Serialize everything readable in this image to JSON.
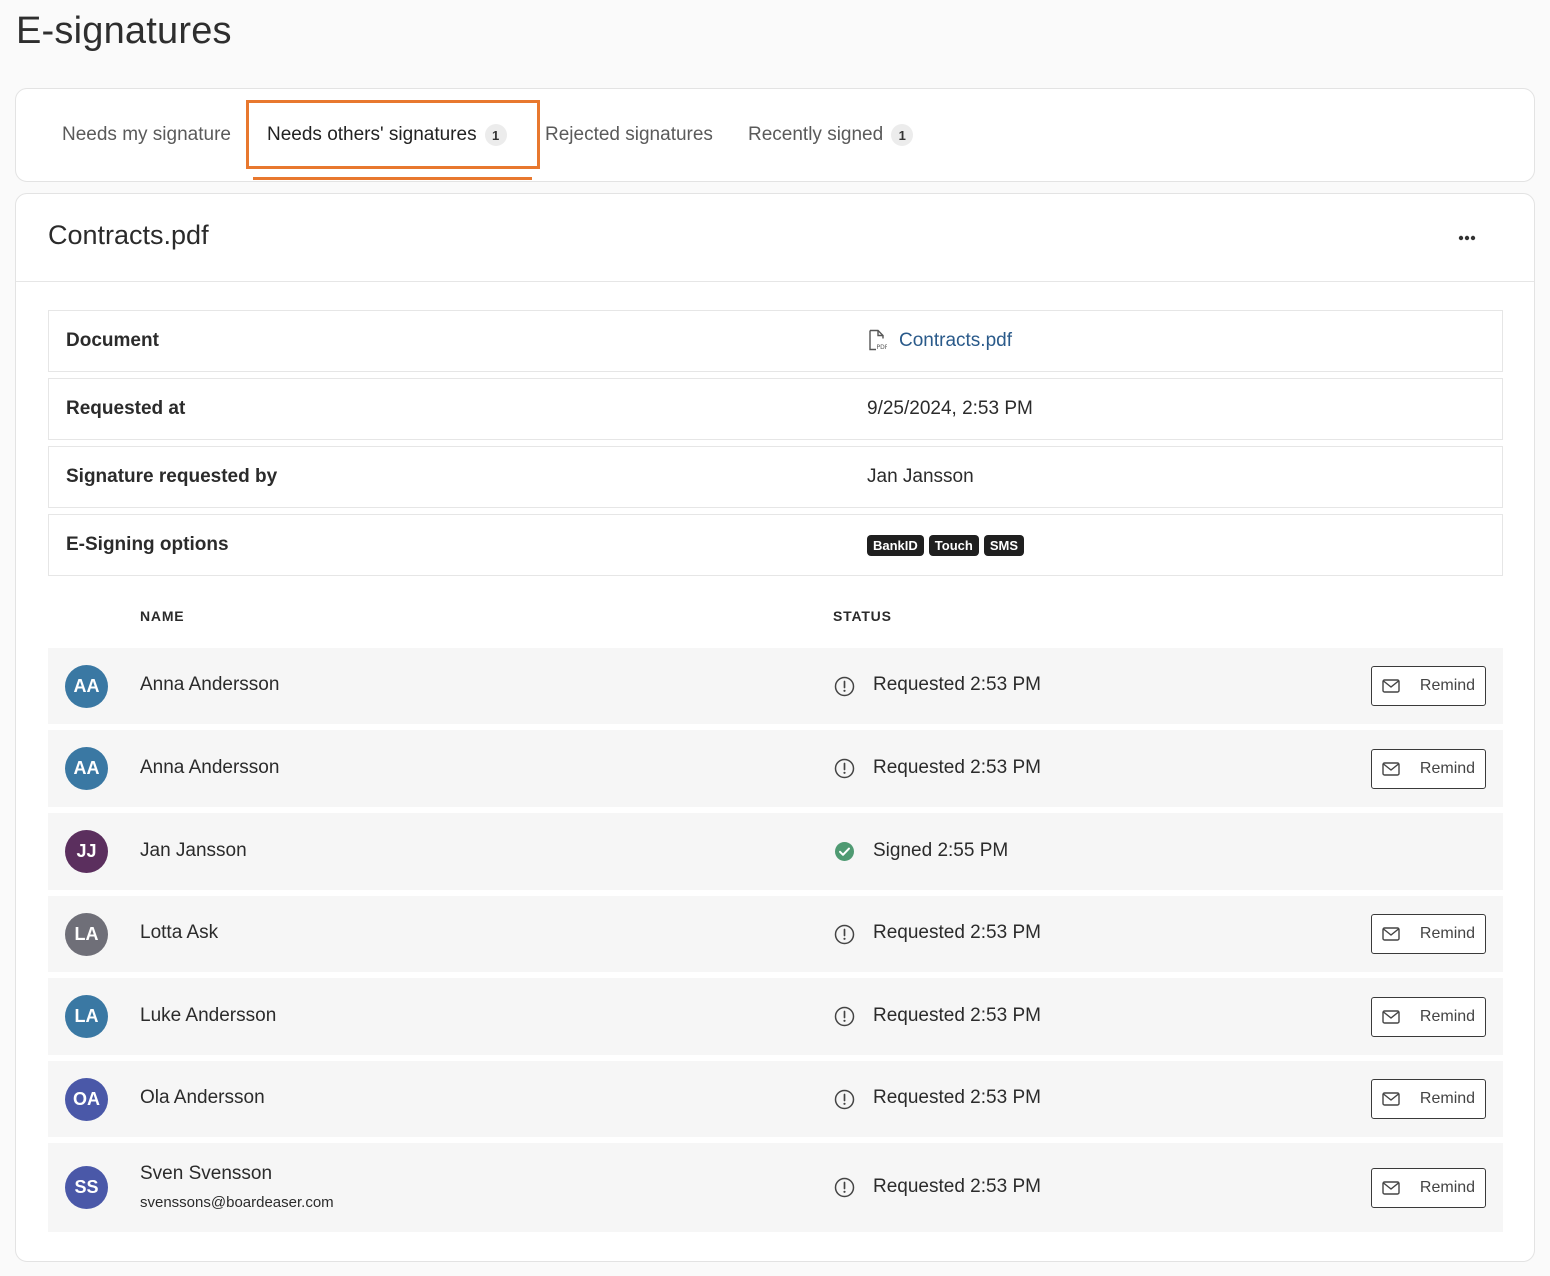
{
  "page": {
    "title": "E-signatures"
  },
  "tabs": [
    {
      "label": "Needs my signature",
      "badge": ""
    },
    {
      "label": "Needs others' signatures",
      "badge": "1"
    },
    {
      "label": "Rejected signatures",
      "badge": ""
    },
    {
      "label": "Recently signed",
      "badge": "1"
    }
  ],
  "active_tab_index": 1,
  "accent_color": "#e8782e",
  "card": {
    "title": "Contracts.pdf",
    "more_icon": "ellipsis-icon",
    "details": {
      "document_label": "Document",
      "document_value": "Contracts.pdf",
      "document_icon": "pdf-file-icon",
      "requested_at_label": "Requested at",
      "requested_at_value": "9/25/2024, 2:53 PM",
      "requested_by_label": "Signature requested by",
      "requested_by_value": "Jan Jansson",
      "options_label": "E-Signing options",
      "options": [
        "BankID",
        "Touch",
        "SMS"
      ]
    }
  },
  "table": {
    "name_header": "NAME",
    "status_header": "STATUS",
    "remind_label": "Remind",
    "rows": [
      {
        "initials": "AA",
        "name": "Anna Andersson",
        "email": "",
        "status": "Requested 2:53 PM",
        "signed": false,
        "avatar_color": "#3a78a3"
      },
      {
        "initials": "AA",
        "name": "Anna Andersson",
        "email": "",
        "status": "Requested 2:53 PM",
        "signed": false,
        "avatar_color": "#3a78a3"
      },
      {
        "initials": "JJ",
        "name": "Jan Jansson",
        "email": "",
        "status": "Signed 2:55 PM",
        "signed": true,
        "avatar_color": "#5b2f5e"
      },
      {
        "initials": "LA",
        "name": "Lotta Ask",
        "email": "",
        "status": "Requested 2:53 PM",
        "signed": false,
        "avatar_color": "#6f6f78"
      },
      {
        "initials": "LA",
        "name": "Luke Andersson",
        "email": "",
        "status": "Requested 2:53 PM",
        "signed": false,
        "avatar_color": "#3a78a3"
      },
      {
        "initials": "OA",
        "name": "Ola Andersson",
        "email": "",
        "status": "Requested 2:53 PM",
        "signed": false,
        "avatar_color": "#4a58a8"
      },
      {
        "initials": "SS",
        "name": "Sven Svensson",
        "email": "svenssons@boardeaser.com",
        "status": "Requested 2:53 PM",
        "signed": false,
        "avatar_color": "#4a58a8"
      }
    ]
  }
}
